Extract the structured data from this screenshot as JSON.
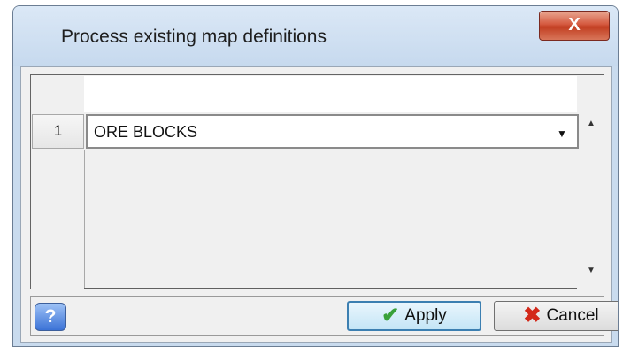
{
  "window": {
    "title": "Process existing map definitions",
    "close_label": "X"
  },
  "grid": {
    "rows": [
      {
        "number": "1",
        "value": "ORE BLOCKS"
      }
    ]
  },
  "footer": {
    "help_label": "?",
    "apply_label": "Apply",
    "cancel_label": "Cancel"
  },
  "icons": {
    "close": "close-icon",
    "help": "help-icon",
    "apply": "checkmark-icon",
    "cancel": "cross-icon",
    "dropdown": "chevron-down-icon",
    "scroll_up": "scroll-up-arrow-icon",
    "scroll_down": "scroll-down-arrow-icon"
  },
  "colors": {
    "title_bar": "#c6d9ee",
    "close_button": "#c23f22",
    "apply_check": "#3aa13a",
    "cancel_x": "#d3291a",
    "help_button": "#3b72d6"
  }
}
